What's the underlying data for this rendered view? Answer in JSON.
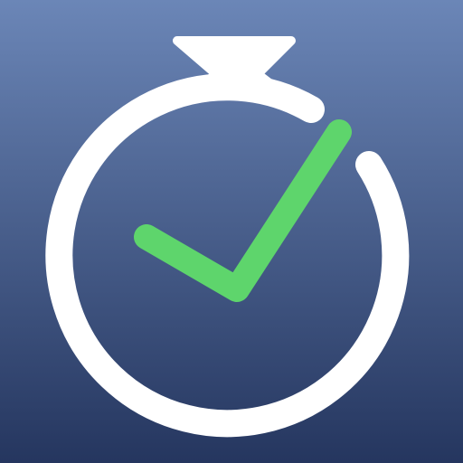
{
  "icon": {
    "name": "stopwatch-checkmark-icon",
    "colors": {
      "gradient_top": "#6B86B7",
      "gradient_bottom": "#25365F",
      "ring": "#FFFFFF",
      "check": "#5ED56C"
    }
  }
}
